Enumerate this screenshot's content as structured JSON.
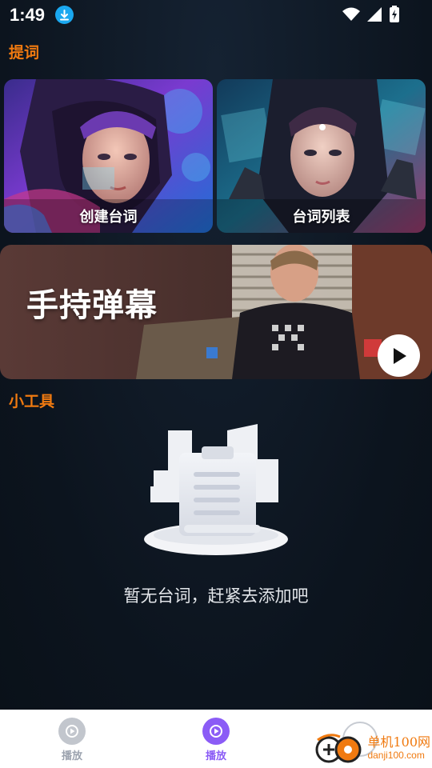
{
  "status": {
    "time": "1:49"
  },
  "sections": {
    "prompts_title": "提词",
    "tools_title": "小工具"
  },
  "cards": [
    {
      "label": "创建台词"
    },
    {
      "label": "台词列表"
    }
  ],
  "banner": {
    "title": "手持弹幕"
  },
  "empty": {
    "text": "暂无台词，赶紧去添加吧"
  },
  "nav": {
    "items": [
      {
        "label": "播放",
        "active": false
      },
      {
        "label": "播放",
        "active": true
      }
    ]
  },
  "watermark": {
    "brand": "单机100网",
    "domain": "danji100.com"
  },
  "colors": {
    "accent": "#f07a10",
    "nav_active": "#8b5cf6",
    "nav_inactive": "#9ca3af",
    "background": "#0e1722"
  }
}
